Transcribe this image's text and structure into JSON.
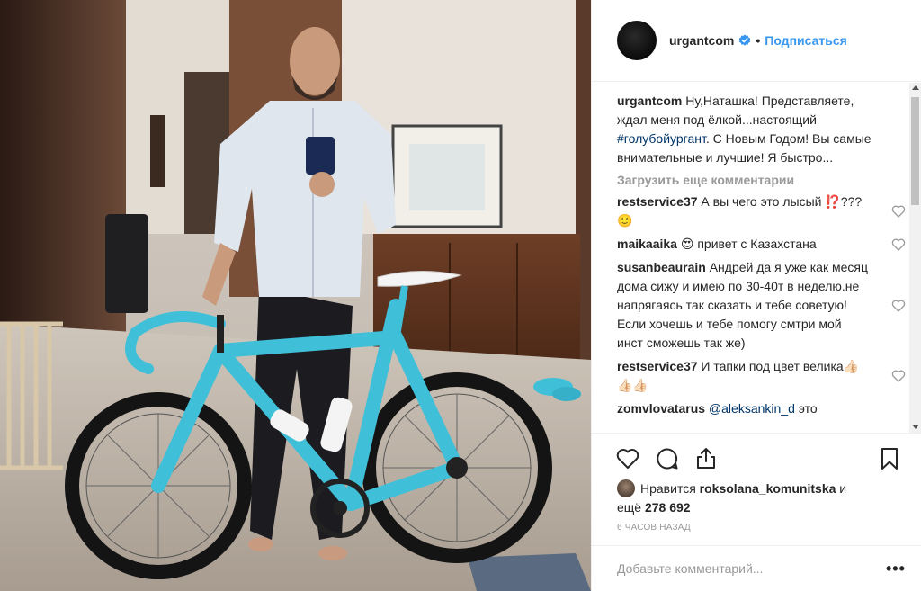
{
  "header": {
    "username": "urgantcom",
    "verified_icon": "verified-badge-icon",
    "separator": "•",
    "follow_label": "Подписаться"
  },
  "caption": {
    "username": "urgantcom",
    "text_before": " Ну,Наташка! Представляете, ждал меня под ёлкой...настоящий ",
    "hashtag": "#голубойургант",
    "text_after": ". С Новым Годом! Вы самые внимательные и лучшие! Я быстро..."
  },
  "load_more_label": "Загрузить еще комментарии",
  "comments": [
    {
      "username": "restservice37",
      "text": " А вы чего это лысый ⁉️???🙂"
    },
    {
      "username": "maikaaika",
      "text": " 😍 привет с Казахстана"
    },
    {
      "username": "susanbeaurain",
      "text": " Андрей да я уже как месяц дома сижу и имею по 30-40т в неделю.не напрягаясь так сказать и тебе советую!Если хочешь и тебе помогу смтри мой инст сможешь так же)"
    },
    {
      "username": "restservice37",
      "text": " И тапки под цвет велика👍🏻👍🏻👍🏻"
    },
    {
      "username": "zomvlovatarus",
      "mention": "@aleksankin_d",
      "text": " это"
    }
  ],
  "likes": {
    "prefix": "Нравится ",
    "user": "roksolana_komunitska",
    "middle": " и",
    "line2_prefix": "ещё ",
    "count": "278 692"
  },
  "timestamp": "6 ЧАСОВ НАЗАД",
  "add_comment_placeholder": "Добавьте комментарий...",
  "more_label": "•••",
  "colors": {
    "link_blue": "#3897f0",
    "hashtag_blue": "#003569",
    "muted_gray": "#999999",
    "bike_turquoise": "#3fc0d8"
  }
}
